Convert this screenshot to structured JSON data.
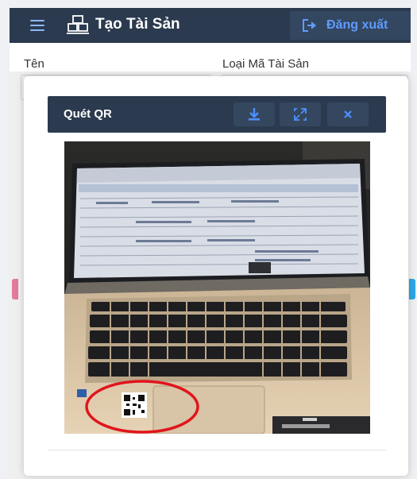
{
  "header": {
    "title": "Tạo Tài Sản",
    "logout_label": "Đăng xuất"
  },
  "form": {
    "name_label": "Tên",
    "asset_code_type_label": "Loại Mã Tài Sản"
  },
  "dialog": {
    "title": "Quét QR"
  },
  "colors": {
    "header_bg": "#2b3a4e",
    "accent_blue": "#5f9bff",
    "scan_highlight": "#e0151c"
  },
  "icons": [
    "menu-icon",
    "asset-boxes-icon",
    "logout-icon",
    "download-icon",
    "expand-icon",
    "close-icon"
  ]
}
